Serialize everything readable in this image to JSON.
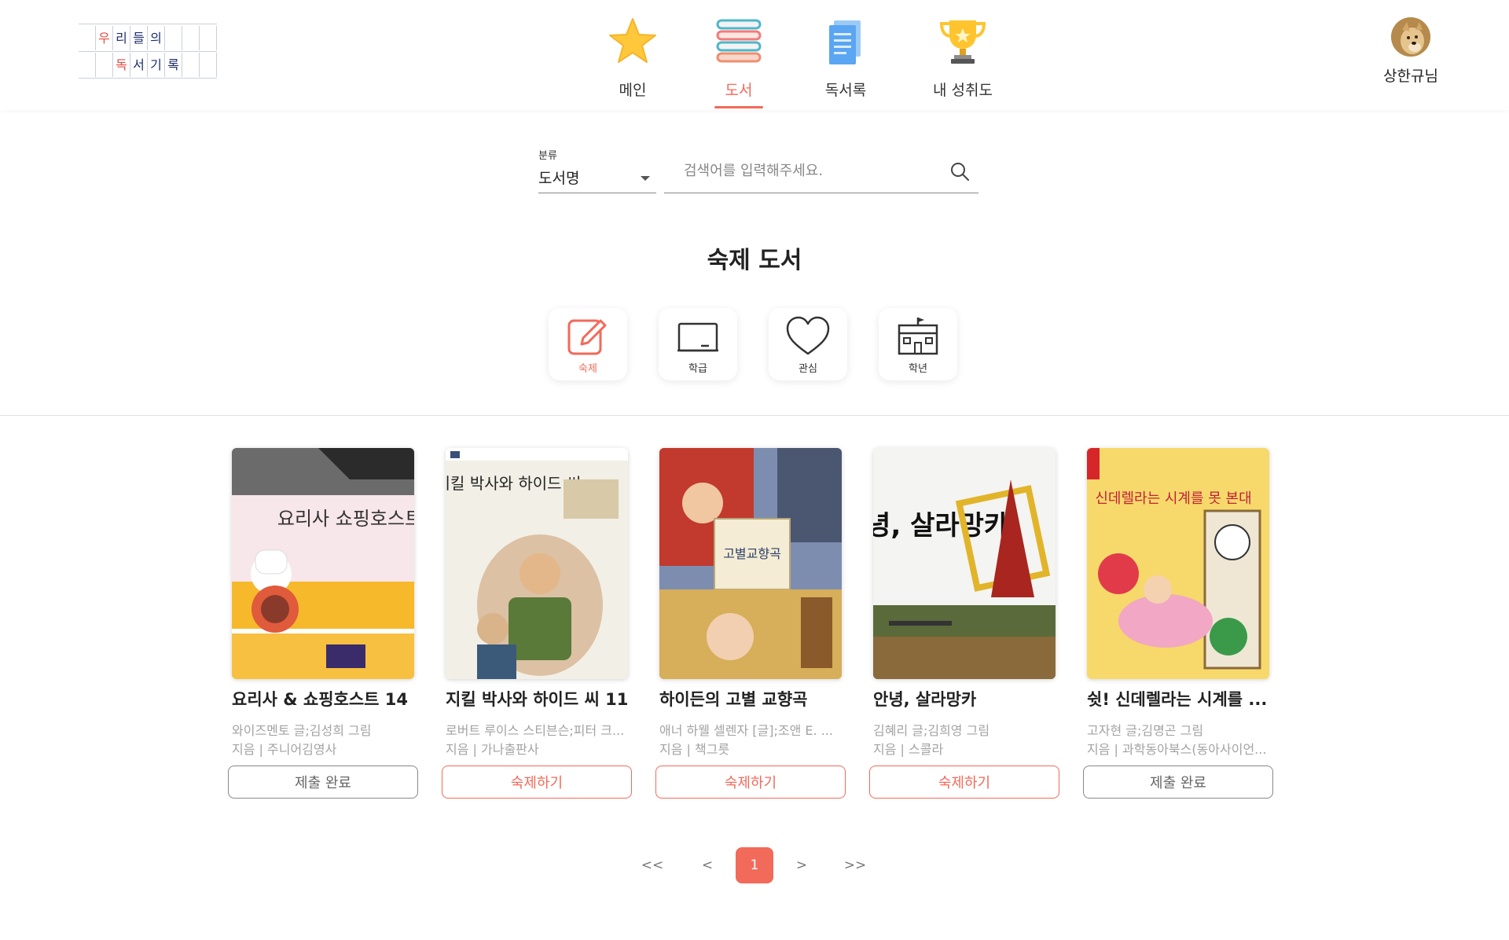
{
  "logo": {
    "row1": [
      "우",
      "리",
      "들",
      "의"
    ],
    "row2": [
      "독",
      "서",
      "기",
      "록"
    ]
  },
  "nav": {
    "items": [
      {
        "label": "메인",
        "icon": "star-icon",
        "active": false
      },
      {
        "label": "도서",
        "icon": "books-icon",
        "active": true
      },
      {
        "label": "독서록",
        "icon": "document-icon",
        "active": false
      },
      {
        "label": "내 성취도",
        "icon": "trophy-icon",
        "active": false
      }
    ]
  },
  "user": {
    "name": "상한규님",
    "avatar": "dog-avatar"
  },
  "search": {
    "category_label": "분류",
    "category_value": "도서명",
    "placeholder": "검색어를 입력해주세요.",
    "value": ""
  },
  "section": {
    "title": "숙제 도서"
  },
  "filters": [
    {
      "label": "숙제",
      "icon": "edit-icon",
      "active": true
    },
    {
      "label": "학급",
      "icon": "blackboard-icon",
      "active": false
    },
    {
      "label": "관심",
      "icon": "heart-icon",
      "active": false
    },
    {
      "label": "학년",
      "icon": "school-icon",
      "active": false
    }
  ],
  "books": [
    {
      "title": "요리사 & 쇼핑호스트 14",
      "author": "와이즈멘토 글;김성희 그림",
      "publisher": "지음 | 주니어김영사",
      "button": "제출 완료",
      "status": "done",
      "cover_title": "요리사 쇼핑호스트"
    },
    {
      "title": "지킬 박사와 하이드 씨 11",
      "author": "로버트 루이스 스티븐슨;피터 크...",
      "publisher": "지음 | 가나출판사",
      "button": "숙제하기",
      "status": "todo",
      "cover_title": "지킬 박사와 하이드 씨"
    },
    {
      "title": "하이든의 고별 교향곡",
      "author": "애너 하웰 셀렌자 [글];조앤 E. ...",
      "publisher": "지음 | 책그릇",
      "button": "숙제하기",
      "status": "todo",
      "cover_title": "고별교향곡"
    },
    {
      "title": "안녕, 살라망카",
      "author": "김혜리 글;김희영 그림",
      "publisher": "지음 | 스콜라",
      "button": "숙제하기",
      "status": "todo",
      "cover_title": "안녕, 살라망카"
    },
    {
      "title": "쉿! 신데렐라는 시계를 ...",
      "author": "고자현 글;김명곤 그림",
      "publisher": "지음 | 과학동아북스(동아사이언...",
      "button": "제출 완료",
      "status": "done",
      "cover_title": "신데렐라는 시계를 못 본대"
    }
  ],
  "pagination": {
    "first": "<<",
    "prev": "<",
    "current": "1",
    "next": ">",
    "last": ">>"
  },
  "colors": {
    "accent": "#f26a5a",
    "text": "#222222",
    "muted": "#a3a3a3"
  }
}
